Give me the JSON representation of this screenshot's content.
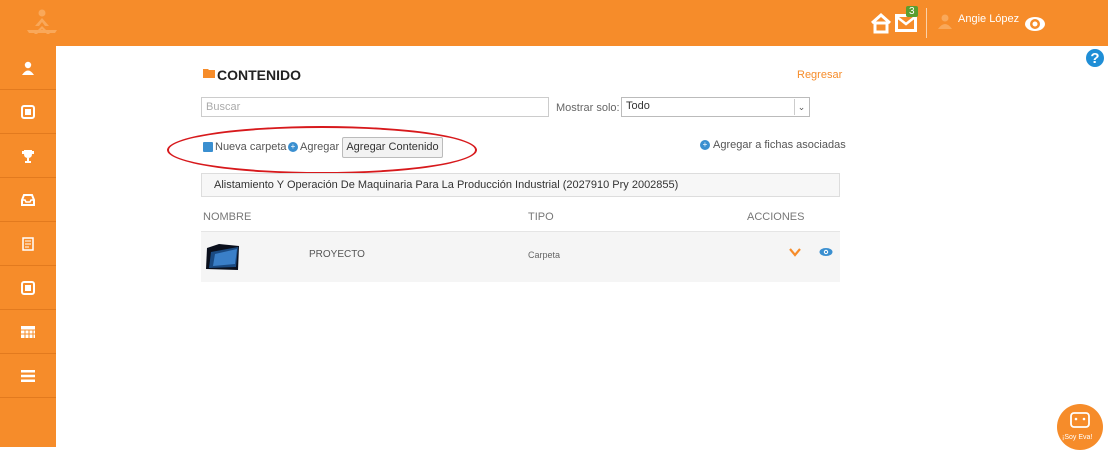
{
  "header": {
    "mail_count": "3",
    "user_name": "Angie López"
  },
  "page": {
    "title": "CONTENIDO",
    "back_label": "Regresar"
  },
  "search": {
    "placeholder": "Buscar"
  },
  "filter": {
    "label": "Mostrar solo:",
    "selected": "Todo"
  },
  "actions": {
    "new_folder": "Nueva carpeta",
    "add": "Agregar",
    "add_content": "Agregar Contenido",
    "add_assoc": "Agregar a fichas asociadas"
  },
  "course": {
    "name": "Alistamiento Y Operación De Maquinaria Para La Producción Industrial (2027910 Pry 2002855)"
  },
  "table": {
    "columns": [
      "NOMBRE",
      "TIPO",
      "ACCIONES"
    ],
    "rows": [
      {
        "name": "PROYECTO",
        "type": "Carpeta"
      }
    ]
  },
  "sidebar": {
    "items": [
      {
        "icon": "user-icon"
      },
      {
        "icon": "id-card-icon"
      },
      {
        "icon": "trophy-icon"
      },
      {
        "icon": "inbox-icon"
      },
      {
        "icon": "document-icon"
      },
      {
        "icon": "id-card-icon"
      },
      {
        "icon": "calendar-icon"
      },
      {
        "icon": "menu-icon"
      }
    ]
  },
  "eva": {
    "label": "¡Soy Eva!"
  },
  "colors": {
    "accent": "#f68c2a",
    "link": "#3a8fd0",
    "annotation": "#d7191c"
  }
}
